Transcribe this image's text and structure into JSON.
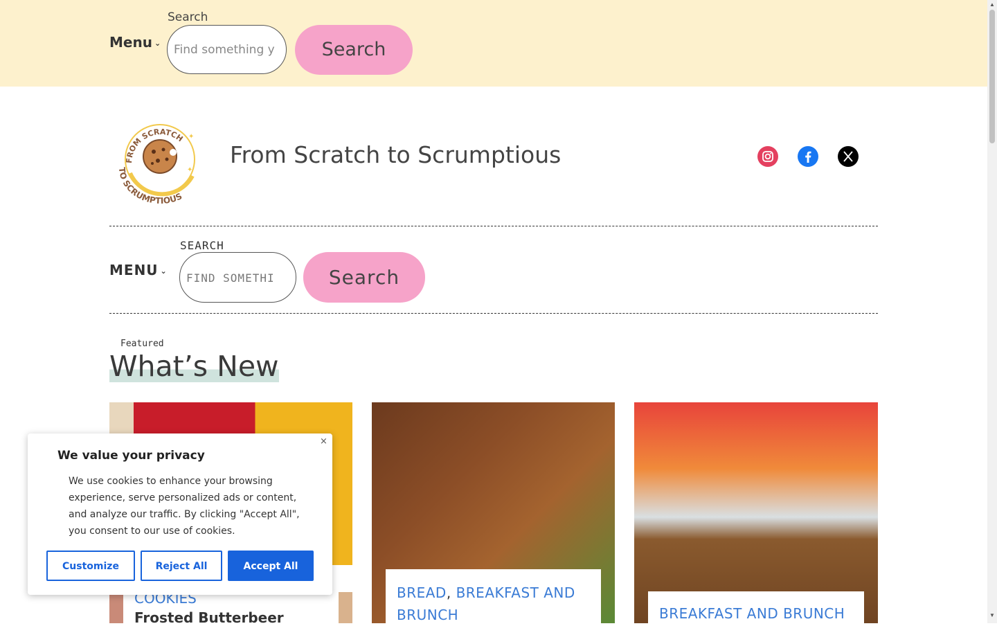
{
  "top_bar": {
    "menu_label": "Menu",
    "chevron": "⌄",
    "search_label": "Search",
    "search_placeholder": "Find something y",
    "search_button": "Search",
    "bg_color": "#fdf1cd"
  },
  "header": {
    "site_title": "From Scratch to Scrumptious",
    "logo_text_top": "FROM SCRATCH",
    "logo_text_bottom": "TO SCRUMPTIOUS",
    "social": [
      {
        "name": "instagram-icon",
        "color": "#e4405f"
      },
      {
        "name": "facebook-icon",
        "color": "#1877f2"
      },
      {
        "name": "x-icon",
        "color": "#000000"
      }
    ]
  },
  "nav": {
    "menu_label": "MENU",
    "chevron": "⌄",
    "search_label": "SEARCH",
    "search_placeholder": "FIND SOMETHI",
    "search_button": "Search",
    "button_color": "#f6a3c9"
  },
  "featured": {
    "eyebrow": "Featured",
    "heading": "What’s New"
  },
  "cards": [
    {
      "category": "COOKIES",
      "title": "Frosted Butterbeer"
    },
    {
      "categories": [
        "BREAD",
        "BREAKFAST AND BRUNCH"
      ],
      "separator": ","
    },
    {
      "category": "BREAKFAST AND BRUNCH"
    }
  ],
  "cookie_banner": {
    "title": "We value your privacy",
    "text": "We use cookies to enhance your browsing experience, serve personalized ads or content, and analyze our traffic. By clicking \"Accept All\", you consent to our use of cookies.",
    "close": "×",
    "customize": "Customize",
    "reject": "Reject All",
    "accept": "Accept All",
    "accent_color": "#1863dc"
  }
}
